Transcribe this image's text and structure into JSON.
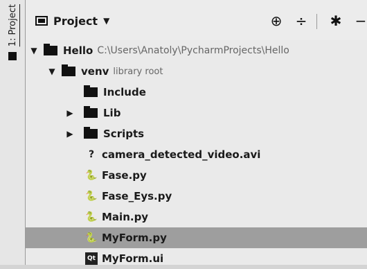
{
  "side_tab": {
    "label": "1: Project"
  },
  "toolbar": {
    "view_label": "Project",
    "caret": "▼",
    "buttons": [
      {
        "name": "locate-icon",
        "glyph": "⊕"
      },
      {
        "name": "collapse-all-icon",
        "glyph": "÷"
      },
      {
        "name": "settings-icon",
        "glyph": "✱"
      },
      {
        "name": "hide-icon",
        "glyph": "−"
      }
    ]
  },
  "tree": {
    "project": {
      "name": "Hello",
      "path": "C:\\Users\\Anatoly\\PycharmProjects\\Hello"
    },
    "venv": {
      "name": "venv",
      "note": "library root"
    },
    "items": [
      {
        "name": "Include",
        "type": "folder",
        "expandable": false
      },
      {
        "name": "Lib",
        "type": "folder",
        "expandable": true
      },
      {
        "name": "Scripts",
        "type": "folder",
        "expandable": true
      },
      {
        "name": "camera_detected_video.avi",
        "type": "unknown"
      },
      {
        "name": "Fase.py",
        "type": "python"
      },
      {
        "name": "Fase_Eys.py",
        "type": "python"
      },
      {
        "name": "Main.py",
        "type": "python"
      },
      {
        "name": "MyForm.py",
        "type": "python",
        "selected": true
      },
      {
        "name": "MyForm.ui",
        "type": "qt"
      }
    ]
  },
  "icons": {
    "qt_label": "Qt"
  }
}
